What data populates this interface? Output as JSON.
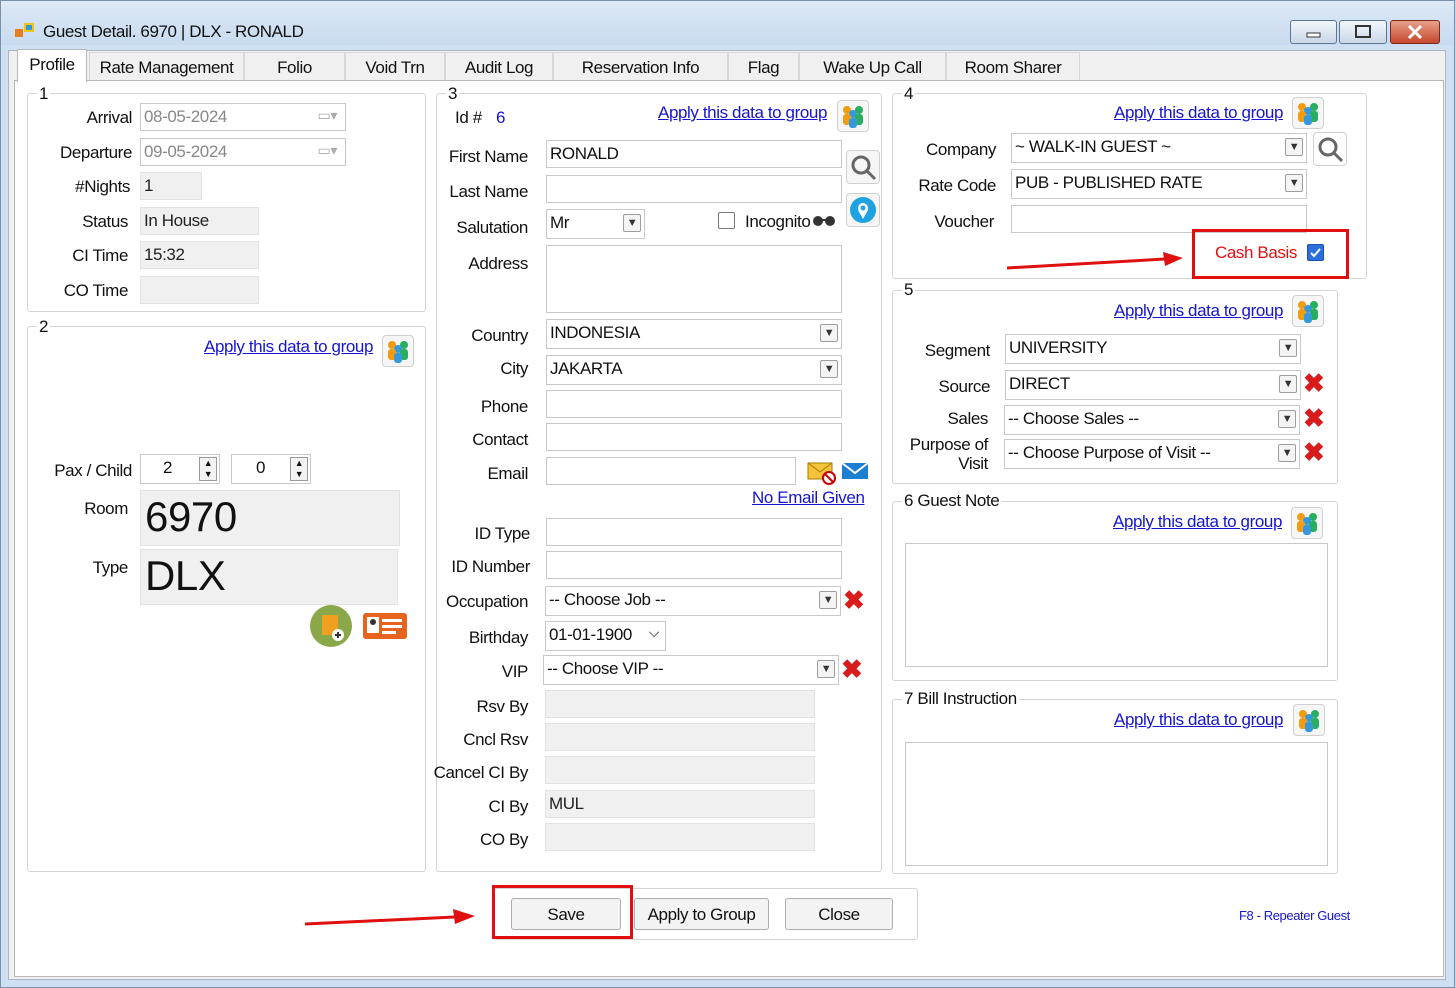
{
  "window": {
    "title": "Guest Detail. 6970 | DLX - RONALD"
  },
  "tabs": [
    "Profile",
    "Rate Management",
    "Folio",
    "Void Trn",
    "Audit Log",
    "Reservation Info",
    "Flag",
    "Wake Up Call",
    "Room Sharer"
  ],
  "g1": {
    "num": "1",
    "arrival_label": "Arrival",
    "arrival": "08-05-2024",
    "departure_label": "Departure",
    "departure": "09-05-2024",
    "nights_label": "#Nights",
    "nights": "1",
    "status_label": "Status",
    "status": "In House",
    "ci_label": "CI Time",
    "ci": "15:32",
    "co_label": "CO Time",
    "co": ""
  },
  "g2": {
    "num": "2",
    "apply": "Apply this data to group",
    "pax_label": "Pax / Child",
    "pax": "2",
    "child": "0",
    "room_label": "Room",
    "room": "6970",
    "type_label": "Type",
    "type": "DLX"
  },
  "g3": {
    "num": "3",
    "id_label": "Id #",
    "id": "6",
    "apply": "Apply this data to group",
    "first_label": "First Name",
    "first": "RONALD",
    "last_label": "Last Name",
    "last": "",
    "sal_label": "Salutation",
    "sal": "Mr",
    "incognito": "Incognito",
    "address_label": "Address",
    "address": "",
    "country_label": "Country",
    "country": "INDONESIA",
    "city_label": "City",
    "city": "JAKARTA",
    "phone_label": "Phone",
    "contact_label": "Contact",
    "email_label": "Email",
    "no_email": "No Email Given",
    "idtype_label": "ID Type",
    "idnum_label": "ID Number",
    "occ_label": "Occupation",
    "occ": "-- Choose Job --",
    "bday_label": "Birthday",
    "bday": "01-01-1900",
    "vip_label": "VIP",
    "vip": "-- Choose VIP --",
    "rsv_label": "Rsv By",
    "cncl_label": "Cncl Rsv",
    "cancelci_label": "Cancel CI By",
    "ciby_label": "CI By",
    "ciby": "MUL",
    "coby_label": "CO By"
  },
  "g4": {
    "num": "4",
    "apply": "Apply this data to group",
    "company_label": "Company",
    "company": "~ WALK-IN GUEST ~",
    "rate_label": "Rate Code",
    "rate": "PUB - PUBLISHED RATE",
    "voucher_label": "Voucher",
    "cash": "Cash Basis",
    "cash_checked": true
  },
  "g5": {
    "num": "5",
    "apply": "Apply this data to group",
    "segment_label": "Segment",
    "segment": "UNIVERSITY",
    "source_label": "Source",
    "source": "DIRECT",
    "sales_label": "Sales",
    "sales": "-- Choose Sales --",
    "purpose_label1": "Purpose of",
    "purpose_label2": "Visit",
    "purpose": "-- Choose Purpose of Visit --"
  },
  "g6": {
    "title": "6 Guest Note",
    "apply": "Apply this data to group"
  },
  "g7": {
    "title": "7 Bill Instruction",
    "apply": "Apply this data to group"
  },
  "buttons": {
    "save": "Save",
    "apply_group": "Apply to Group",
    "close": "Close"
  },
  "hint": "F8 - Repeater Guest",
  "colors": {
    "highlight": "#e01010",
    "link": "#1515d0",
    "field_readonly": "#f0f0f0"
  }
}
